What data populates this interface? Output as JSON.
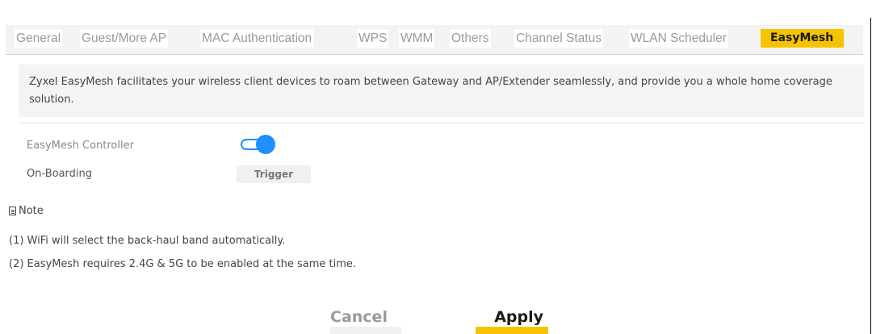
{
  "tabs": [
    {
      "label": "General",
      "active": false
    },
    {
      "label": "Guest/More AP",
      "active": false
    },
    {
      "label": "MAC Authentication",
      "active": false
    },
    {
      "label": "WPS",
      "active": false
    },
    {
      "label": "WMM",
      "active": false
    },
    {
      "label": "Others",
      "active": false
    },
    {
      "label": "Channel Status",
      "active": false
    },
    {
      "label": "WLAN Scheduler",
      "active": false
    },
    {
      "label": "EasyMesh",
      "active": true
    }
  ],
  "description": "Zyxel EasyMesh facilitates your wireless client devices to roam between Gateway and AP/Extender seamlessly, and provide you a whole home coverage solution.",
  "settings": {
    "controller_label": "EasyMesh Controller",
    "controller_enabled": true,
    "onboarding_label": "On-Boarding",
    "trigger_label": "Trigger"
  },
  "note": {
    "title": "Note",
    "lines": [
      "(1) WiFi will select the back-haul band automatically.",
      "(2) EasyMesh requires 2.4G & 5G to be enabled at the same time."
    ]
  },
  "actions": {
    "cancel_label": "Cancel",
    "apply_label": "Apply"
  },
  "colors": {
    "accent": "#f5c400",
    "toggle_on": "#1e90ff"
  }
}
